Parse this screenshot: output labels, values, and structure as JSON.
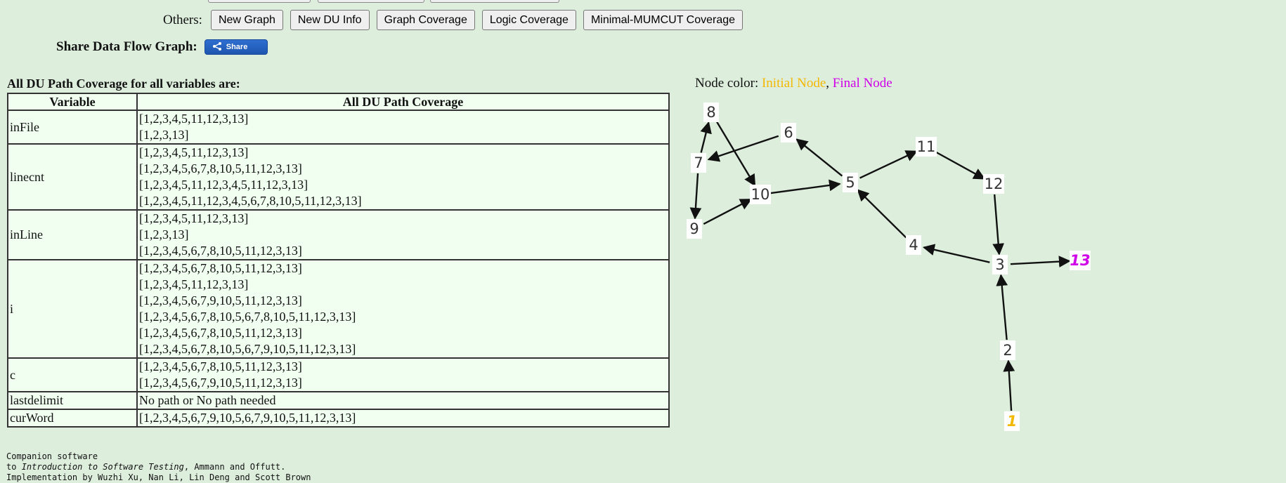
{
  "others": {
    "label": "Others:",
    "buttons": [
      "New Graph",
      "New DU Info",
      "Graph Coverage",
      "Logic Coverage",
      "Minimal-MUMCUT Coverage"
    ]
  },
  "share": {
    "label": "Share Data Flow Graph:",
    "button_label": "Share"
  },
  "table": {
    "title": "All DU Path Coverage for all variables are:",
    "headers": [
      "Variable",
      "All DU Path Coverage"
    ],
    "rows": [
      {
        "variable": "inFile",
        "paths": [
          "[1,2,3,4,5,11,12,3,13]",
          "[1,2,3,13]"
        ]
      },
      {
        "variable": "linecnt",
        "paths": [
          "[1,2,3,4,5,11,12,3,13]",
          "[1,2,3,4,5,6,7,8,10,5,11,12,3,13]",
          "[1,2,3,4,5,11,12,3,4,5,11,12,3,13]",
          "[1,2,3,4,5,11,12,3,4,5,6,7,8,10,5,11,12,3,13]"
        ]
      },
      {
        "variable": "inLine",
        "paths": [
          "[1,2,3,4,5,11,12,3,13]",
          "[1,2,3,13]",
          "[1,2,3,4,5,6,7,8,10,5,11,12,3,13]"
        ]
      },
      {
        "variable": "i",
        "paths": [
          "[1,2,3,4,5,6,7,8,10,5,11,12,3,13]",
          "[1,2,3,4,5,11,12,3,13]",
          "[1,2,3,4,5,6,7,9,10,5,11,12,3,13]",
          "[1,2,3,4,5,6,7,8,10,5,6,7,8,10,5,11,12,3,13]",
          "[1,2,3,4,5,6,7,8,10,5,11,12,3,13]",
          "[1,2,3,4,5,6,7,8,10,5,6,7,9,10,5,11,12,3,13]"
        ]
      },
      {
        "variable": "c",
        "paths": [
          "[1,2,3,4,5,6,7,8,10,5,11,12,3,13]",
          "[1,2,3,4,5,6,7,9,10,5,11,12,3,13]"
        ]
      },
      {
        "variable": "lastdelimit",
        "paths": [
          "No path or No path needed"
        ]
      },
      {
        "variable": "curWord",
        "paths": [
          "[1,2,3,4,5,6,7,9,10,5,6,7,9,10,5,11,12,3,13]"
        ]
      }
    ]
  },
  "legend": {
    "prefix": "Node color: ",
    "initial": "Initial Node",
    "separator": ", ",
    "final": "Final Node",
    "initial_color": "#f5b800",
    "final_color": "#d000e8"
  },
  "graph": {
    "nodes": [
      {
        "id": "1",
        "type": "initial"
      },
      {
        "id": "2",
        "type": "normal"
      },
      {
        "id": "3",
        "type": "normal"
      },
      {
        "id": "4",
        "type": "normal"
      },
      {
        "id": "5",
        "type": "normal"
      },
      {
        "id": "6",
        "type": "normal"
      },
      {
        "id": "7",
        "type": "normal"
      },
      {
        "id": "8",
        "type": "normal"
      },
      {
        "id": "9",
        "type": "normal"
      },
      {
        "id": "10",
        "type": "normal"
      },
      {
        "id": "11",
        "type": "normal"
      },
      {
        "id": "12",
        "type": "normal"
      },
      {
        "id": "13",
        "type": "final"
      }
    ],
    "edges": [
      [
        "1",
        "2"
      ],
      [
        "2",
        "3"
      ],
      [
        "3",
        "13"
      ],
      [
        "3",
        "4"
      ],
      [
        "4",
        "5"
      ],
      [
        "5",
        "11"
      ],
      [
        "11",
        "12"
      ],
      [
        "12",
        "3"
      ],
      [
        "5",
        "6"
      ],
      [
        "6",
        "7"
      ],
      [
        "7",
        "8"
      ],
      [
        "7",
        "9"
      ],
      [
        "8",
        "10"
      ],
      [
        "9",
        "10"
      ],
      [
        "10",
        "5"
      ]
    ]
  },
  "footer": {
    "line1": "Companion software",
    "line2_prefix": "to ",
    "line2_title": "Introduction to Software Testing",
    "line2_suffix": ", Ammann and Offutt.",
    "line3": "Implementation by Wuzhi Xu, Nan Li, Lin Deng and Scott Brown"
  }
}
